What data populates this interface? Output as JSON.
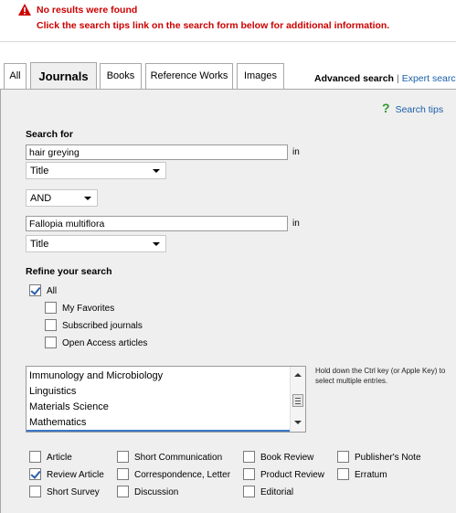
{
  "alert": {
    "title": "No results were found",
    "message": "Click the search tips link on the search form below for additional information."
  },
  "tabs": [
    {
      "label": "All"
    },
    {
      "label": "Journals"
    },
    {
      "label": "Books"
    },
    {
      "label": "Reference Works"
    },
    {
      "label": "Images"
    }
  ],
  "toplinks": {
    "advanced": "Advanced search",
    "separator": "|",
    "expert": "Expert search"
  },
  "search_tips": "Search tips",
  "search_for_label": "Search for",
  "term1": {
    "value": "hair greying",
    "in_label": "in",
    "field": "Title"
  },
  "operator": "AND",
  "term2": {
    "value": "Fallopia multiflora",
    "in_label": "in",
    "field": "Title"
  },
  "refine": {
    "label": "Refine your search",
    "all_label": "All",
    "all_checked": true,
    "options": [
      {
        "label": "My Favorites",
        "checked": false
      },
      {
        "label": "Subscribed journals",
        "checked": false
      },
      {
        "label": "Open Access articles",
        "checked": false
      }
    ]
  },
  "subject_list": {
    "items": [
      "Immunology and Microbiology",
      "Linguistics",
      "Materials Science",
      "Mathematics"
    ],
    "hint": "Hold down the Ctrl key (or Apple Key) to select multiple entries."
  },
  "article_types": [
    {
      "label": "Article",
      "checked": false
    },
    {
      "label": "Short Communication",
      "checked": false
    },
    {
      "label": "Book Review",
      "checked": false
    },
    {
      "label": "Publisher's Note",
      "checked": false
    },
    {
      "label": "Review Article",
      "checked": true
    },
    {
      "label": "Correspondence, Letter",
      "checked": false
    },
    {
      "label": "Product Review",
      "checked": false
    },
    {
      "label": "Erratum",
      "checked": false
    },
    {
      "label": "Short Survey",
      "checked": false
    },
    {
      "label": "Discussion",
      "checked": false
    },
    {
      "label": "Editorial",
      "checked": false
    }
  ],
  "colors": {
    "alert": "#cc0000",
    "link": "#1a5fa8",
    "panel": "#efefef",
    "tips_icon": "#2e9a2e"
  }
}
